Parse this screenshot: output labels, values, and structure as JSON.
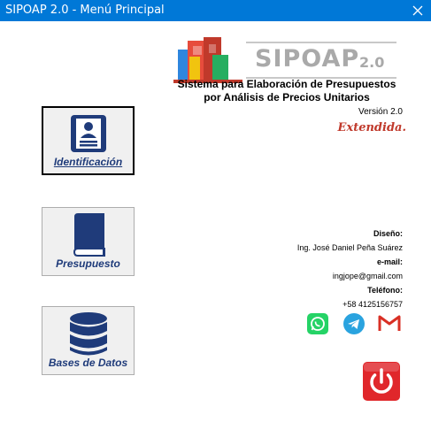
{
  "window": {
    "title": "SIPOAP 2.0 - Menú Principal"
  },
  "logo": {
    "name": "SIPOAP",
    "version": "2.0"
  },
  "subtitle": {
    "line1": "Sistema para Elaboración de Presupuestos",
    "line2": "por Análisis de Precios Unitarios"
  },
  "version_text": "Versión 2.0",
  "edition": "Extendida.",
  "buttons": {
    "identificacion": "Identificación",
    "presupuesto": "Presupuesto",
    "bases": "Bases de Datos"
  },
  "contact": {
    "design_label": "Diseño:",
    "designer": "Ing. José Daniel Peña Suárez",
    "email_label": "e-mail:",
    "email": "ingjope@gmail.com",
    "phone_label": "Teléfono:",
    "phone": "+58 4125156757"
  },
  "colors": {
    "titlebar": "#0078d7",
    "icon_navy": "#1f3b7a",
    "accent_red": "#c0392b",
    "whatsapp": "#25d366",
    "telegram": "#2aa3df",
    "power": "#e0272b"
  },
  "icons": [
    "close-icon",
    "id-card-icon",
    "book-icon",
    "database-icon",
    "whatsapp-icon",
    "telegram-icon",
    "gmail-icon",
    "power-icon"
  ]
}
